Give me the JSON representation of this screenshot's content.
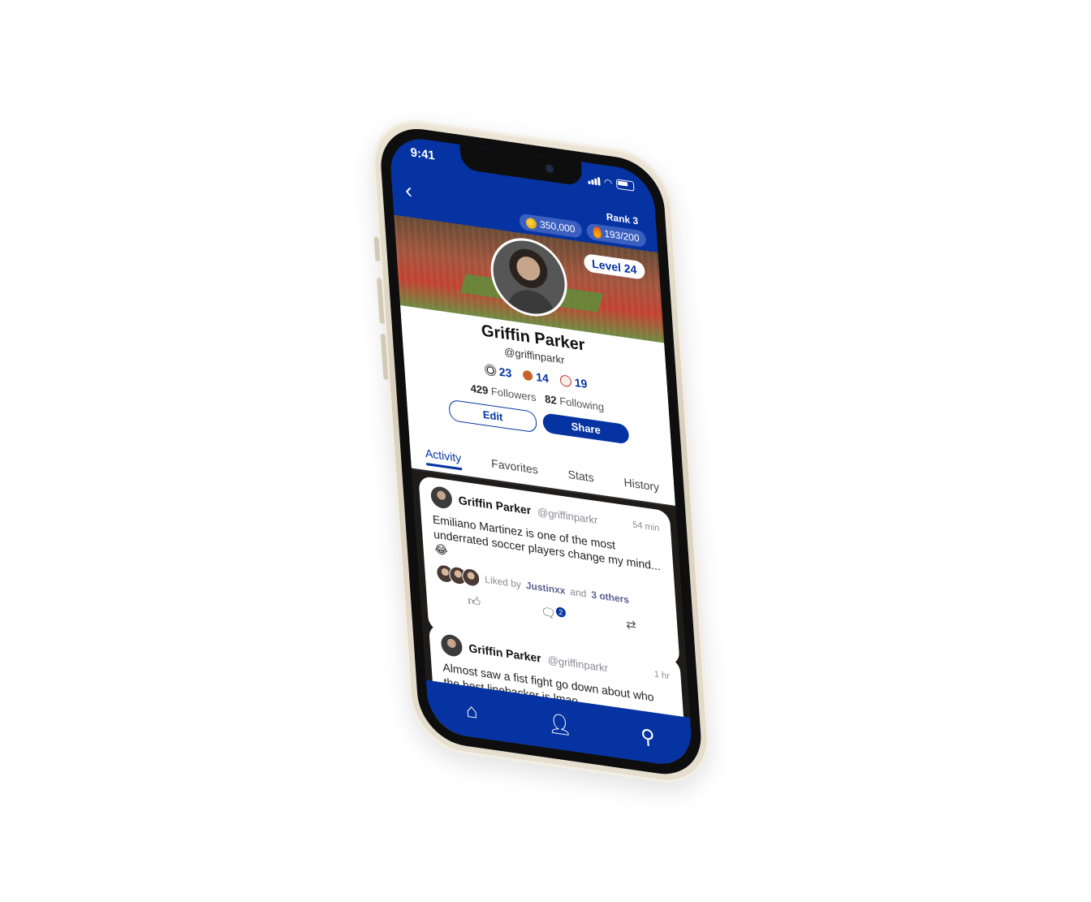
{
  "status": {
    "time": "9:41"
  },
  "header": {
    "rank": "Rank 3",
    "coins": "350,000",
    "streak": "193/200",
    "level": "Level 24"
  },
  "profile": {
    "name": "Griffin Parker",
    "handle": "@griffinparkr",
    "sports": [
      {
        "icon": "soccer-ball-icon",
        "count": "23"
      },
      {
        "icon": "basketball-icon",
        "count": "14"
      },
      {
        "icon": "baseball-icon",
        "count": "19"
      }
    ],
    "followers_count": "429",
    "followers_label": "Followers",
    "following_count": "82",
    "following_label": "Following",
    "edit_label": "Edit",
    "share_label": "Share"
  },
  "tabs": [
    "Activity",
    "Favorites",
    "Stats",
    "History"
  ],
  "active_tab": "Activity",
  "posts": [
    {
      "name": "Griffin Parker",
      "handle": "@griffinparkr",
      "time": "54 min",
      "text": "Emiliano Martinez is one of the most underrated soccer players change my mind... 😂",
      "liked_prefix": "Liked by",
      "liked_user": "Justinxx",
      "liked_and": "and",
      "liked_others": "3 others",
      "comment_count": "2"
    },
    {
      "name": "Griffin Parker",
      "handle": "@griffinparkr",
      "time": "1 hr",
      "text": "Almost saw a fist fight go down about who the best linebacker is lmao..."
    }
  ],
  "nav": [
    "home-icon",
    "profile-icon",
    "search-icon"
  ],
  "colors": {
    "brand_blue": "#0533a2",
    "feed_background": "#1e1b1b",
    "phone_frame": "#e2dac9"
  }
}
